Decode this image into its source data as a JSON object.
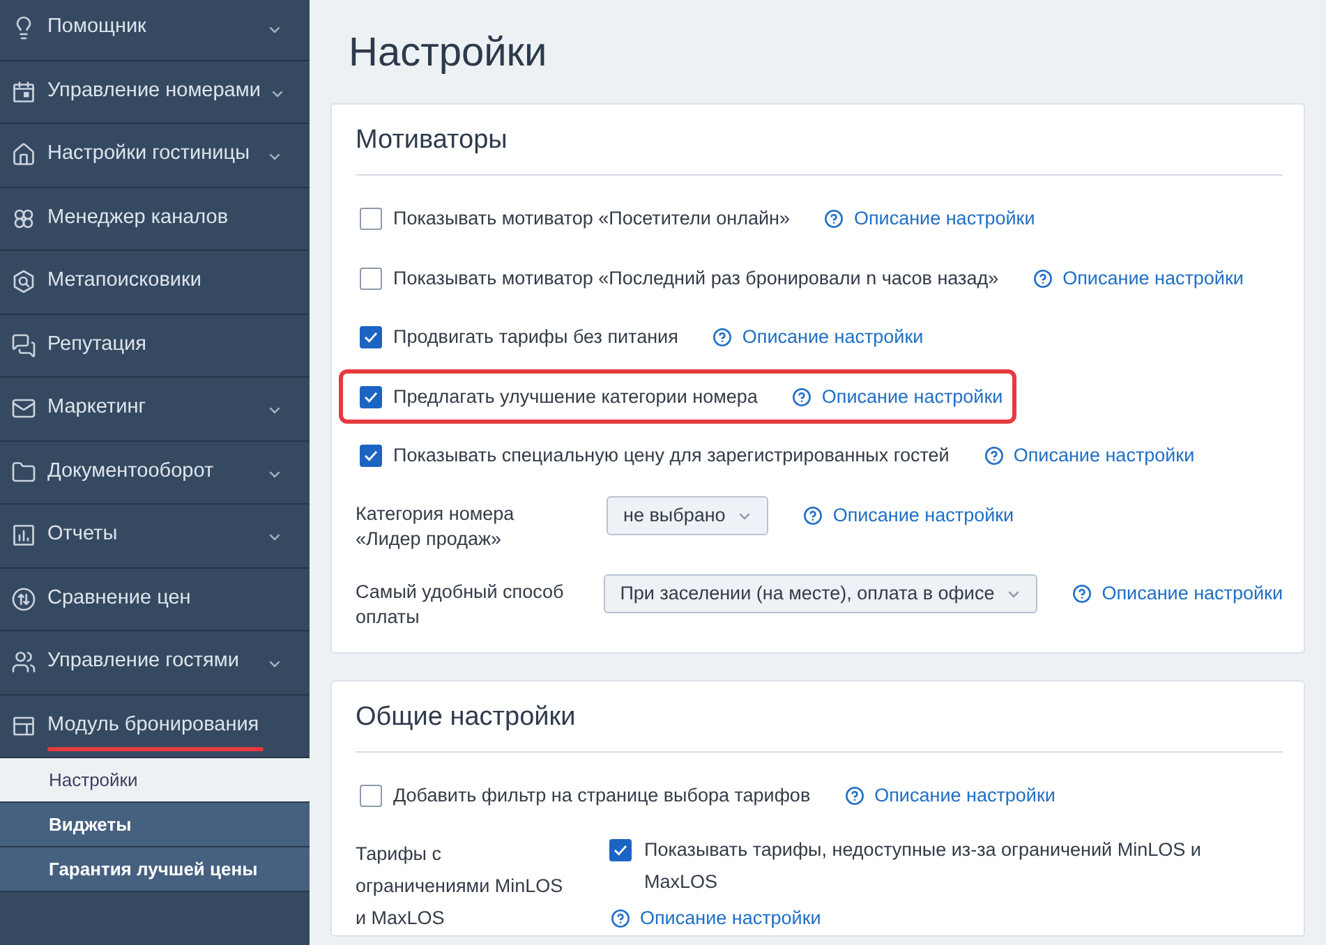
{
  "sidebar": {
    "items": [
      {
        "label": "Помощник",
        "expandable": true,
        "highlighted": false
      },
      {
        "label": "Управление номерами",
        "expandable": true,
        "highlighted": false
      },
      {
        "label": "Настройки гостиницы",
        "expandable": true,
        "highlighted": false
      },
      {
        "label": "Менеджер каналов",
        "expandable": false,
        "highlighted": false
      },
      {
        "label": "Метапоисковики",
        "expandable": false,
        "highlighted": false
      },
      {
        "label": "Репутация",
        "expandable": false,
        "highlighted": false
      },
      {
        "label": "Маркетинг",
        "expandable": true,
        "highlighted": false
      },
      {
        "label": "Документооборот",
        "expandable": true,
        "highlighted": false
      },
      {
        "label": "Отчеты",
        "expandable": true,
        "highlighted": false
      },
      {
        "label": "Сравнение цен",
        "expandable": false,
        "highlighted": false
      },
      {
        "label": "Управление гостями",
        "expandable": true,
        "highlighted": false
      },
      {
        "label": "Модуль бронирования",
        "expandable": false,
        "highlighted": true,
        "children": [
          {
            "label": "Настройки",
            "selected": true
          },
          {
            "label": "Виджеты",
            "selected": false
          },
          {
            "label": "Гарантия лучшей цены",
            "selected": false
          }
        ]
      }
    ]
  },
  "page": {
    "title": "Настройки"
  },
  "sections": [
    {
      "title": "Мотиваторы",
      "rows": [
        {
          "kind": "checkbox",
          "label": "Показывать мотиватор «Посетители онлайн»",
          "checked": false,
          "highlighted": false,
          "help": "Описание настройки"
        },
        {
          "kind": "checkbox",
          "label": "Показывать мотиватор «Последний раз бронировали n часов назад»",
          "checked": false,
          "highlighted": false,
          "help": "Описание настройки"
        },
        {
          "kind": "checkbox",
          "label": "Продвигать тарифы без питания",
          "checked": true,
          "highlighted": false,
          "help": "Описание настройки"
        },
        {
          "kind": "checkbox",
          "label": "Предлагать улучшение категории номера",
          "checked": true,
          "highlighted": true,
          "help": "Описание настройки"
        },
        {
          "kind": "checkbox",
          "label": "Показывать специальную цену для зарегистрированных гостей",
          "checked": true,
          "highlighted": false,
          "help": "Описание настройки"
        },
        {
          "kind": "select",
          "label": "Категория номера «Лидер продаж»",
          "value": "не выбрано",
          "help": "Описание настройки"
        },
        {
          "kind": "select",
          "label": "Самый удобный способ оплаты",
          "value": "При заселении (на месте), оплата в офисе",
          "help": "Описание настройки"
        }
      ]
    },
    {
      "title": "Общие настройки",
      "rows": [
        {
          "kind": "checkbox",
          "label": "Добавить фильтр на странице выбора тарифов",
          "checked": false,
          "highlighted": false,
          "help": "Описание настройки"
        },
        {
          "kind": "checkbox_field",
          "label": "Тарифы с ограничениями MinLOS и MaxLOS",
          "checkbox_label": "Показывать тарифы, недоступные из-за ограничений MinLOS и MaxLOS",
          "checked": true,
          "help": "Описание настройки"
        }
      ]
    }
  ]
}
